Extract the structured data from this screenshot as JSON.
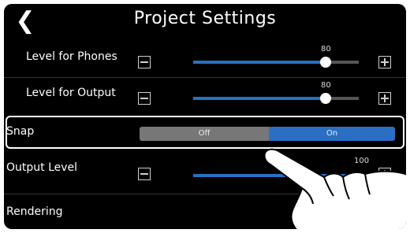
{
  "header": {
    "back_icon": "chevron-left-icon",
    "title": "Project Settings"
  },
  "rows": {
    "phones": {
      "label": "Level for Phones",
      "value": "80",
      "level": 0.8
    },
    "output": {
      "label": "Level for Output",
      "value": "80",
      "level": 0.8
    },
    "snap": {
      "label": "Snap",
      "off_label": "Off",
      "on_label": "On",
      "selected": "On"
    },
    "output_level": {
      "label": "Output Level",
      "value": "100",
      "level": 1.0
    },
    "rendering": {
      "label": "Rendering"
    }
  },
  "colors": {
    "accent": "#2a6fc4",
    "background": "#000000",
    "inactive_segment": "#777777"
  }
}
